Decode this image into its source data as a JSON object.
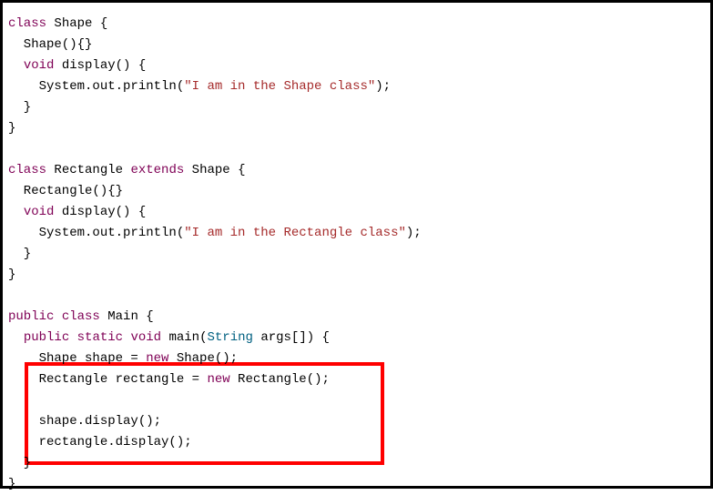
{
  "code": {
    "l1": {
      "kw_class": "class",
      "name": "Shape",
      "brace": " {"
    },
    "l2": {
      "ctor": "  Shape(){}"
    },
    "l3": {
      "kw_void": "void",
      "indent": "  ",
      "name": " display() {"
    },
    "l4": {
      "indent": "    System.out.println(",
      "str": "\"I am in the Shape class\"",
      "end": ");"
    },
    "l5": {
      "text": "  }"
    },
    "l6": {
      "text": "}"
    },
    "blank1": "",
    "l7": {
      "kw_class": "class",
      "name": "Rectangle",
      "kw_extends": "extends",
      "parent": "Shape",
      "brace": " {"
    },
    "l8": {
      "ctor": "  Rectangle(){}"
    },
    "l9": {
      "kw_void": "void",
      "indent": "  ",
      "name": " display() {"
    },
    "l10": {
      "indent": "    System.out.println(",
      "str": "\"I am in the Rectangle class\"",
      "end": ");"
    },
    "l11": {
      "text": "  }"
    },
    "l12": {
      "text": "}"
    },
    "blank2": "",
    "l13": {
      "kw_public": "public",
      "kw_class": "class",
      "name": "Main",
      "brace": " {"
    },
    "l14": {
      "indent": "  ",
      "kw_public": "public",
      "kw_static": "static",
      "kw_void": "void",
      "name": " main(",
      "type": "String",
      "args": " args[]) {"
    },
    "l15": {
      "indent": "    Shape shape = ",
      "kw_new": "new",
      "rest": " Shape();"
    },
    "l16": {
      "indent": "    Rectangle rectangle = ",
      "kw_new": "new",
      "rest": " Rectangle();"
    },
    "blank3": "",
    "l17": {
      "text": "    shape.display();"
    },
    "l18": {
      "text": "    rectangle.display();"
    },
    "l19": {
      "text": "  }"
    },
    "l20": {
      "text": "}"
    }
  }
}
